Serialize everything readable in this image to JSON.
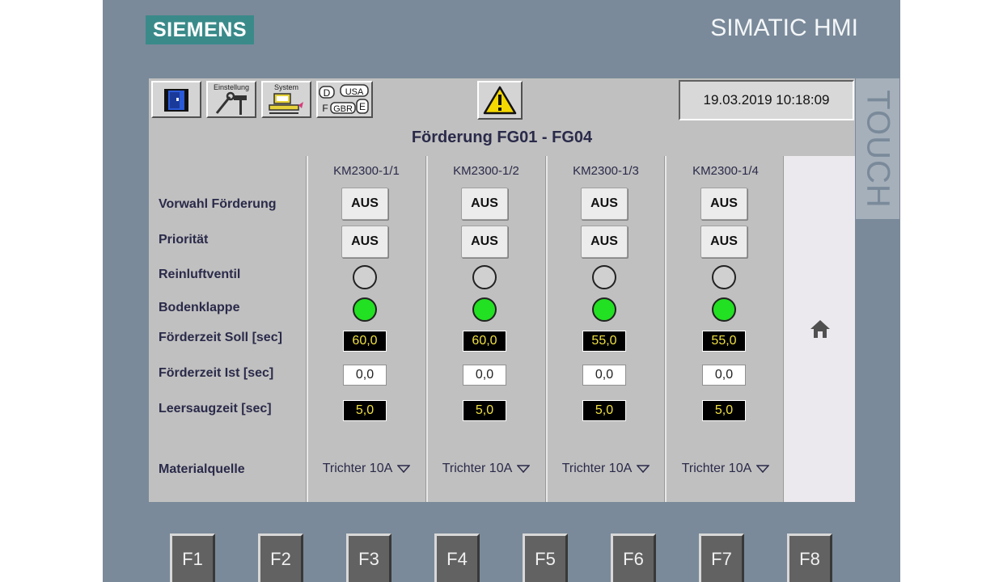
{
  "device": {
    "brand": "SIEMENS",
    "model": "SIMATIC HMI",
    "touch_label": "TOUCH"
  },
  "toolbar": {
    "exit_label": "",
    "settings_label": "Einstellung",
    "system_label": "System",
    "language_labels": [
      "D",
      "USA",
      "F",
      "GBR",
      "E"
    ]
  },
  "datetime": "19.03.2019 10:18:09",
  "title": "Förderung FG01 - FG04",
  "row_labels": {
    "vorwahl": "Vorwahl Förderung",
    "prioritaet": "Priorität",
    "reinluft": "Reinluftventil",
    "bodenklappe": "Bodenklappe",
    "soll": "Förderzeit Soll [sec]",
    "ist": "Förderzeit Ist [sec]",
    "leersaug": "Leersaugzeit [sec]",
    "material": "Materialquelle"
  },
  "columns": [
    {
      "name": "KM2300-1/1",
      "vorwahl": "AUS",
      "prioritaet": "AUS",
      "reinluft": "off",
      "bodenklappe": "on",
      "soll": "60,0",
      "ist": "0,0",
      "leersaug": "5,0",
      "material": "Trichter 10A"
    },
    {
      "name": "KM2300-1/2",
      "vorwahl": "AUS",
      "prioritaet": "AUS",
      "reinluft": "off",
      "bodenklappe": "on",
      "soll": "60,0",
      "ist": "0,0",
      "leersaug": "5,0",
      "material": "Trichter 10A"
    },
    {
      "name": "KM2300-1/3",
      "vorwahl": "AUS",
      "prioritaet": "AUS",
      "reinluft": "off",
      "bodenklappe": "on",
      "soll": "55,0",
      "ist": "0,0",
      "leersaug": "5,0",
      "material": "Trichter 10A"
    },
    {
      "name": "KM2300-1/4",
      "vorwahl": "AUS",
      "prioritaet": "AUS",
      "reinluft": "off",
      "bodenklappe": "on",
      "soll": "55,0",
      "ist": "0,0",
      "leersaug": "5,0",
      "material": "Trichter 10A"
    }
  ],
  "function_keys": [
    "F1",
    "F2",
    "F3",
    "F4",
    "F5",
    "F6",
    "F7",
    "F8"
  ],
  "colors": {
    "lamp_on": "#22e022",
    "lamp_off": "#d0d0d0",
    "value_text": "#f0e040",
    "bezel": "#7a8a9a",
    "brand_bg": "#3a8a8a"
  }
}
